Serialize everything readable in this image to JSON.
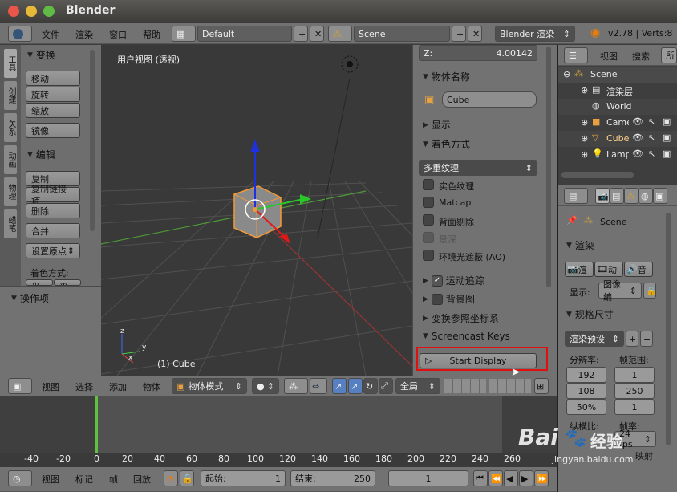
{
  "window": {
    "title": "Blender"
  },
  "info_header": {
    "menus": [
      "文件",
      "渲染",
      "窗口",
      "帮助"
    ],
    "layout": "Default",
    "scene": "Scene",
    "engine": "Blender 渲染",
    "version": "v2.78 | Verts:8"
  },
  "left_tabs": [
    "工具",
    "创建",
    "关系",
    "动画",
    "物理",
    "蜡笔"
  ],
  "tool_panel": {
    "transform_header": "变换",
    "move": "移动",
    "rotate": "旋转",
    "scale": "缩放",
    "mirror": "镜像",
    "edit_header": "编辑",
    "duplicate": "复制",
    "duplicate_linked": "复制链接项",
    "delete": "删除",
    "join": "合并",
    "set_origin": "设置原点",
    "shading_label": "着色方式:",
    "smooth": "光滑",
    "flat": "平直",
    "operator_header": "操作项"
  },
  "viewport": {
    "label": "用户视图 (透视)",
    "object": "(1) Cube",
    "axis_x": "x",
    "axis_y": "y",
    "axis_z": "z"
  },
  "n_panel": {
    "z_field": "Z:",
    "z_value": "4.00142",
    "object_name_header": "物体名称",
    "object_name": "Cube",
    "display_header": "显示",
    "shading_header": "着色方式",
    "texture_mode": "多重纹理",
    "solid_tex": "实色纹理",
    "matcap": "Matcap",
    "backface": "背面剔除",
    "dof": "景深",
    "ao": "环境光遮蔽 (AO)",
    "motion_tracking": "运动追踪",
    "background": "背景图",
    "transform_orient": "变换参照坐标系",
    "screencast_keys": "Screencast Keys",
    "start_display": "Start Display"
  },
  "viewport_header": {
    "view": "视图",
    "select": "选择",
    "add": "添加",
    "object": "物体",
    "mode": "物体模式",
    "pivot": "全局"
  },
  "outliner": {
    "view": "视图",
    "search": "搜索",
    "all": "所",
    "items": [
      "Scene",
      "渲染层",
      "World",
      "Camera",
      "Cube",
      "Lamp"
    ]
  },
  "properties": {
    "scene": "Scene",
    "render_header": "渲染",
    "render_btn": "渲",
    "anim_btn": "动",
    "audio_btn": "音",
    "display_label": "显示:",
    "display_value": "图像编",
    "dimensions_header": "规格尺寸",
    "preset": "渲染预设",
    "resolution_label": "分辨率:",
    "res_x": "192",
    "res_y": "108",
    "res_pct": "50%",
    "frame_range_label": "帧范围:",
    "frame_start": "1",
    "frame_end": "250",
    "frame_step": "1",
    "aspect_label": "纵横比:",
    "fps_label": "帧率:",
    "fps": "24 fps",
    "remap": "映射"
  },
  "timeline": {
    "ticks": [
      "-40",
      "-20",
      "0",
      "20",
      "40",
      "60",
      "80",
      "100",
      "120",
      "140",
      "160",
      "180",
      "200",
      "220",
      "240",
      "260"
    ],
    "view": "视图",
    "marker": "标记",
    "frame": "帧",
    "playback": "回放",
    "start_label": "起始:",
    "start": "1",
    "end_label": "结束:",
    "end": "250",
    "current": "1"
  },
  "watermark": {
    "brand": "Bai",
    "sub": "经验",
    "url": "jingyan.baidu.com"
  },
  "colors": {
    "highlight": "#e01010",
    "accent": "#5680c2"
  }
}
